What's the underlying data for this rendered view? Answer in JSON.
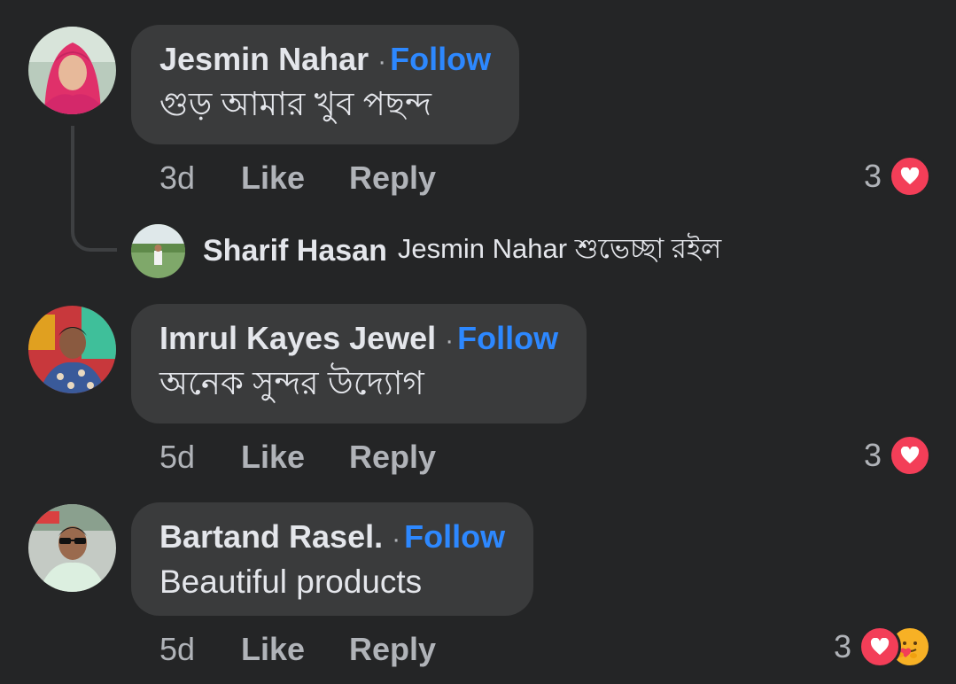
{
  "comments": [
    {
      "author": "Jesmin Nahar",
      "separator": "·",
      "follow": "Follow",
      "text": "গুড় আমার খুব পছন্দ",
      "time": "3d",
      "like": "Like",
      "reply": "Reply",
      "reaction_count": "3",
      "reactions": [
        "heart-icon"
      ],
      "avatar_colors": {
        "bg": "#c9d6cc",
        "accent": "#e0306a"
      }
    },
    {
      "author": "Imrul Kayes Jewel",
      "separator": "·",
      "follow": "Follow",
      "text": "অনেক সুন্দর উদ্যোগ",
      "time": "5d",
      "like": "Like",
      "reply": "Reply",
      "reaction_count": "3",
      "reactions": [
        "heart-icon"
      ],
      "avatar_colors": {
        "bg": "#d04040",
        "accent": "#3a5a9a"
      }
    },
    {
      "author": "Bartand Rasel.",
      "separator": "·",
      "follow": "Follow",
      "text": "Beautiful products",
      "time": "5d",
      "like": "Like",
      "reply": "Reply",
      "reaction_count": "3",
      "reactions": [
        "heart-icon",
        "care-icon"
      ],
      "avatar_colors": {
        "bg": "#b8c0b8",
        "accent": "#e8e8e0"
      }
    }
  ],
  "reply": {
    "author": "Sharif Hasan",
    "text": "Jesmin Nahar শুভেচ্ছা রইল"
  },
  "colors": {
    "background": "#242526",
    "bubble": "#3a3b3c",
    "follow": "#2d88ff",
    "heart": "#f33e58",
    "muted_text": "#b0b3b8"
  }
}
